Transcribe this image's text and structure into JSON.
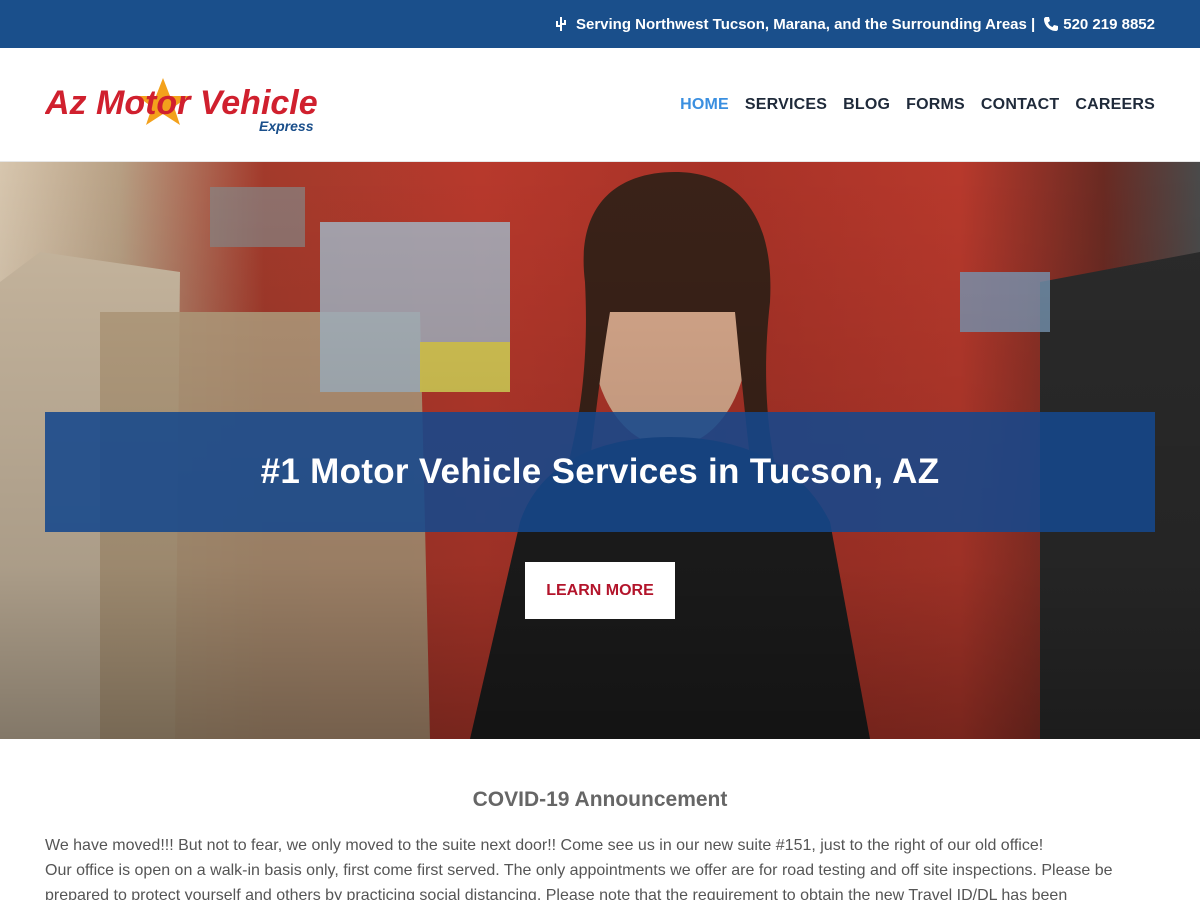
{
  "topbar": {
    "service_area": "Serving Northwest Tucson, Marana, and the Surrounding Areas |",
    "phone": "520 219 8852",
    "icons": [
      "cactus-icon",
      "phone-icon"
    ]
  },
  "logo": {
    "line1": "Az Motor Vehicle",
    "line2": "Express"
  },
  "nav": {
    "items": [
      {
        "label": "HOME",
        "active": true
      },
      {
        "label": "SERVICES",
        "active": false
      },
      {
        "label": "BLOG",
        "active": false
      },
      {
        "label": "FORMS",
        "active": false
      },
      {
        "label": "CONTACT",
        "active": false
      },
      {
        "label": "CAREERS",
        "active": false
      }
    ]
  },
  "hero": {
    "headline": "#1 Motor Vehicle Services in Tucson, AZ",
    "button": "LEARN MORE"
  },
  "announcement": {
    "title": "COVID-19 Announcement",
    "paragraph1": "We have moved!!! But not to fear, we only moved to the suite next door!! Come see us in our new suite #151, just to the right of our old office!",
    "paragraph2": "Our office is open on a walk-in basis only, first come first served. The only appointments we offer are for road testing and off site inspections. Please be prepared to protect yourself and others by practicing social distancing. Please note that the requirement to obtain the new Travel ID/DL has been"
  },
  "colors": {
    "topbar": "#1a4f8b",
    "nav_active": "#3a8fe0",
    "banner": "#16488c",
    "button_text": "#b3142b",
    "logo_red": "#d0202e",
    "logo_blue": "#1a4f8b",
    "logo_star": "#f3a11c"
  }
}
